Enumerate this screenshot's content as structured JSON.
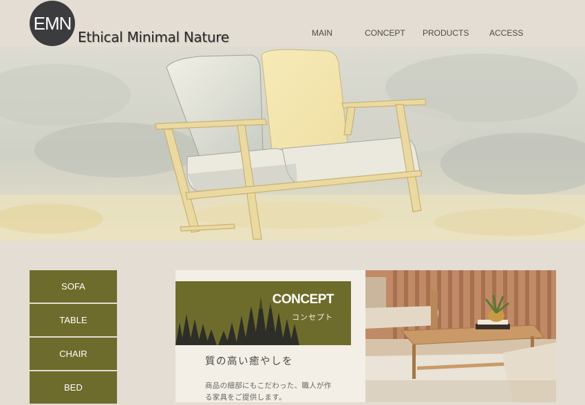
{
  "header": {
    "logo_text": "EMN",
    "brand_name": "Ethical Minimal Nature"
  },
  "nav": {
    "items": [
      {
        "label": "MAIN"
      },
      {
        "label": "CONCEPT"
      },
      {
        "label": "PRODUCTS"
      },
      {
        "label": "ACCESS"
      }
    ]
  },
  "side_menu": {
    "items": [
      {
        "label": "SOFA"
      },
      {
        "label": "TABLE"
      },
      {
        "label": "CHAIR"
      },
      {
        "label": "BED"
      }
    ]
  },
  "concept": {
    "title": "CONCEPT",
    "subtitle": "コンセプト",
    "heading": "質の高い癒やしを",
    "body_line1": "商品の細部にもこだわった、職人が作",
    "body_line2": "る家具をご提供します。"
  },
  "colors": {
    "background": "#e4ddd3",
    "accent_olive": "#6e6c2c",
    "logo_dark": "#3c3c3e",
    "panel_cream": "#f3efe6"
  }
}
